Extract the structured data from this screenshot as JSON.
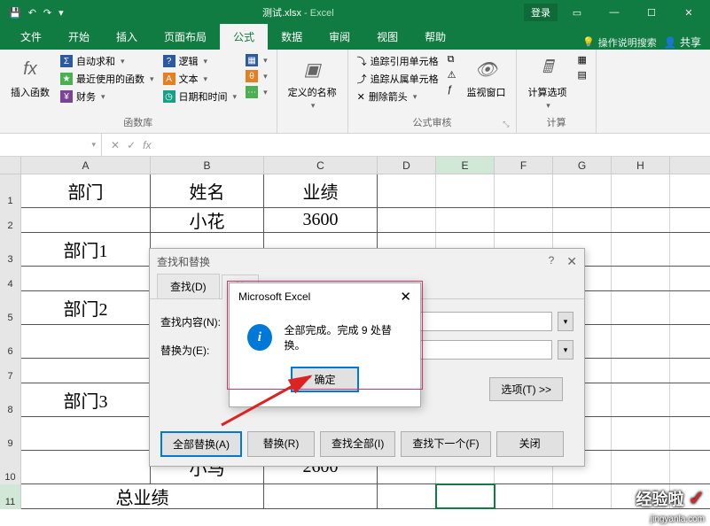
{
  "title": {
    "filename": "测试.xlsx",
    "app": "Excel",
    "login": "登录"
  },
  "tabs": {
    "file": "文件",
    "home": "开始",
    "insert": "插入",
    "layout": "页面布局",
    "formula": "公式",
    "data": "数据",
    "review": "审阅",
    "view": "视图",
    "help": "帮助",
    "tellme": "操作说明搜索",
    "share": "共享"
  },
  "ribbon": {
    "fx": "插入函数",
    "lib": {
      "autosum": "自动求和",
      "recent": "最近使用的函数",
      "financial": "财务",
      "logical": "逻辑",
      "text": "文本",
      "datetime": "日期和时间",
      "label": "函数库"
    },
    "names": {
      "defined": "定义的名称"
    },
    "audit": {
      "precedents": "追踪引用单元格",
      "dependents": "追踪从属单元格",
      "arrows": "删除箭头",
      "watch": "监视窗口",
      "label": "公式审核"
    },
    "calc": {
      "options": "计算选项",
      "label": "计算"
    }
  },
  "columns": [
    "A",
    "B",
    "C",
    "D",
    "E",
    "F",
    "G",
    "H"
  ],
  "rows": [
    "1",
    "2",
    "3",
    "4",
    "5",
    "6",
    "7",
    "8",
    "9",
    "10",
    "11"
  ],
  "cells": {
    "A1": "部门",
    "B1": "姓名",
    "C1": "业绩",
    "B2": "小花",
    "C2": "3600",
    "A3": "部门1",
    "A5": "部门2",
    "A8": "部门3",
    "B10": "小马",
    "C10": "2600",
    "A11": "总业绩"
  },
  "find_dialog": {
    "title": "查找和替换",
    "tab_find": "查找(D)",
    "tab_replace": "替",
    "find_label": "查找内容(N):",
    "replace_label": "替换为(E):",
    "options": "选项(T) >>",
    "replace_all": "全部替换(A)",
    "replace": "替换(R)",
    "find_all": "查找全部(I)",
    "find_next": "查找下一个(F)",
    "close": "关闭"
  },
  "msgbox": {
    "title": "Microsoft Excel",
    "message": "全部完成。完成 9 处替换。",
    "ok": "确定"
  },
  "watermark": {
    "main": "经验啦",
    "sub": "jingyanla.com"
  }
}
